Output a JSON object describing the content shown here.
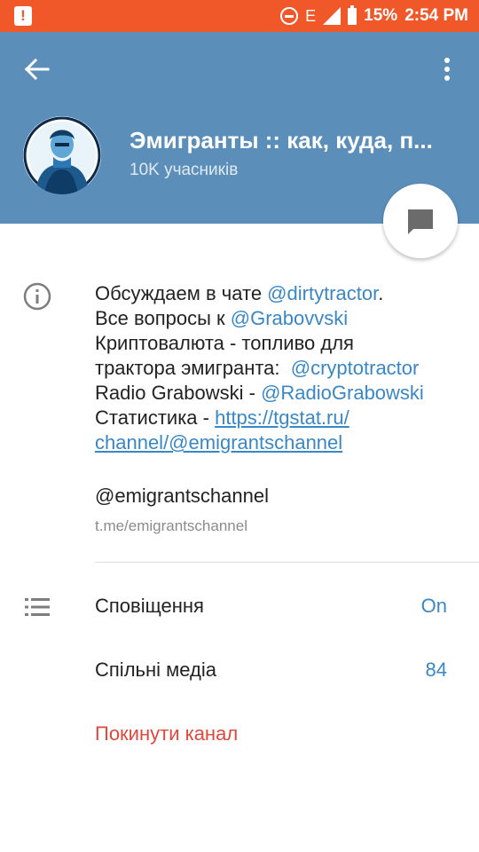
{
  "status_bar": {
    "network": "E",
    "battery": "15%",
    "time": "2:54 PM"
  },
  "header": {
    "title": "Эмигранты :: как, куда, п...",
    "subtitle": "10K учасників",
    "color": "#5b8fba"
  },
  "description": {
    "line1_prefix": "Обсуждаем в чате ",
    "line1_link": "@dirtytractor",
    "line1_suffix": ".",
    "line2_prefix": "Все вопросы к ",
    "line2_link": "@Grabovvski",
    "line3": "Криптовалюта - топливо для",
    "line4_prefix": "трактора эмигранта:  ",
    "line4_link": "@cryptotractor",
    "line5_prefix": "Radio Grabowski - ",
    "line5_link": "@RadioGrabowski",
    "line6_prefix": "Статистика - ",
    "line6_link": "https://tgstat.ru/",
    "line7_link": "channel/@emigrantschannel"
  },
  "username": {
    "value": "@emigrantschannel",
    "link": "t.me/emigrantschannel"
  },
  "settings": [
    {
      "label": "Сповіщення",
      "value": "On"
    },
    {
      "label": "Спільні медіа",
      "value": "84"
    }
  ],
  "leave_label": "Покинути канал",
  "colors": {
    "status_bar": "#f0582a",
    "link": "#3a87c6",
    "danger": "#e0483e"
  }
}
